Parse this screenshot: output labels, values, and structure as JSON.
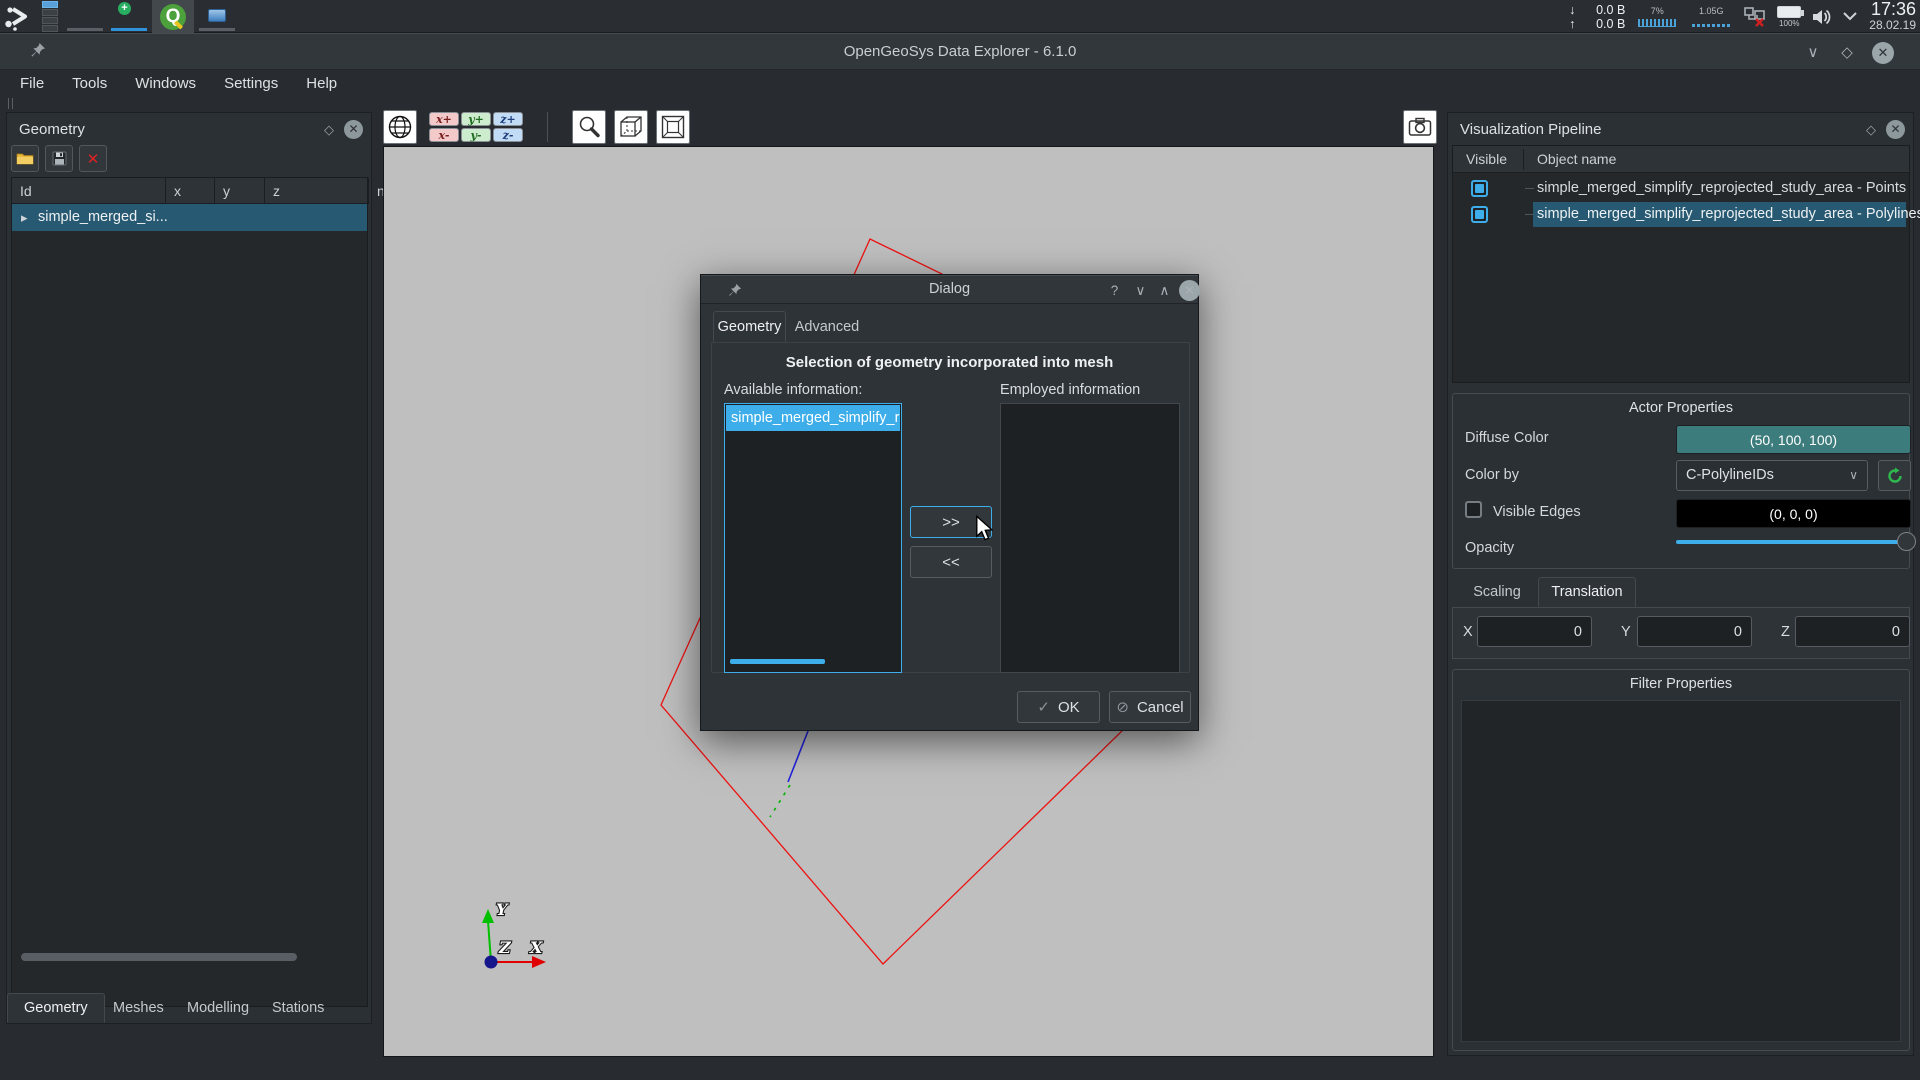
{
  "taskbar": {
    "tray": {
      "net_down": "0.0 B",
      "net_up": "0.0 B",
      "cpu_pct": "7%",
      "mem": "1.05G",
      "battery_pct": "100%",
      "clock_time": "17:36",
      "clock_date": "28.02.19"
    }
  },
  "titlebar": {
    "title": "OpenGeoSys Data Explorer - 6.1.0"
  },
  "menubar": {
    "items": [
      "File",
      "Tools",
      "Windows",
      "Settings",
      "Help"
    ]
  },
  "geometry_dock": {
    "title": "Geometry",
    "columns": [
      "Id",
      "x",
      "y",
      "z",
      "n"
    ],
    "row_label": "simple_merged_si...",
    "tabs": [
      "Geometry",
      "Meshes",
      "Modelling",
      "Stations"
    ]
  },
  "view_toolbar": {
    "axis_buttons": [
      "x+",
      "y+",
      "z+",
      "x-",
      "y-",
      "z-"
    ]
  },
  "dialog": {
    "title": "Dialog",
    "help_glyph": "?",
    "tabs": [
      "Geometry",
      "Advanced"
    ],
    "heading": "Selection of geometry incorporated into mesh",
    "available_label": "Available information:",
    "employed_label": "Employed information",
    "available_items": [
      "simple_merged_simplify_repr"
    ],
    "move_right": ">>",
    "move_left": "<<",
    "ok_label": "OK",
    "cancel_label": "Cancel"
  },
  "pipeline_dock": {
    "title": "Visualization Pipeline",
    "columns": [
      "Visible",
      "Object name"
    ],
    "rows": [
      {
        "name": "simple_merged_simplify_reprojected_study_area - Points",
        "visible": true
      },
      {
        "name": "simple_merged_simplify_reprojected_study_area - Polylines",
        "visible": true,
        "selected": true
      }
    ],
    "actor": {
      "title": "Actor Properties",
      "diffuse_label": "Diffuse Color",
      "diffuse_value": "(50, 100, 100)",
      "colorby_label": "Color by",
      "colorby_value": "C-PolylineIDs",
      "edges_label": "Visible Edges",
      "edges_value": "(0, 0, 0)",
      "opacity_label": "Opacity"
    },
    "transform": {
      "tabs": [
        "Scaling",
        "Translation"
      ],
      "active_tab": "Translation",
      "x_label": "X",
      "y_label": "Y",
      "z_label": "Z",
      "x_value": "0",
      "y_value": "0",
      "z_value": "0"
    },
    "filter_title": "Filter Properties"
  },
  "viewport": {
    "axis_x": "X",
    "axis_y": "Y",
    "axis_z": "Z"
  },
  "colors": {
    "highlight": "#3daee9",
    "selection_teal": "#275a72",
    "diffuse_color": "#3d7c7c",
    "edges_color": "#000000",
    "viewport_bg": "#bfbfbf",
    "polyline_red": "#ee1111",
    "line_blue": "#2222dd",
    "line_green": "#00b400"
  }
}
